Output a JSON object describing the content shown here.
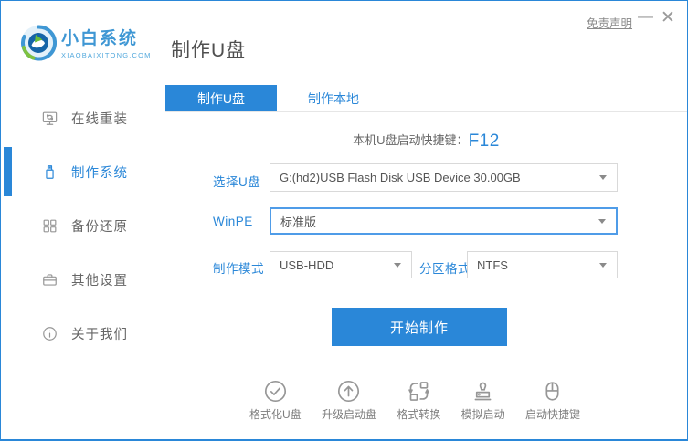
{
  "window_title": "小白系统 - 制作U盘",
  "colors": {
    "primary": "#2a87d8",
    "focus_border": "#4f9ce8",
    "sidebar_text": "#666666",
    "tool_icon": "#969696"
  },
  "header": {
    "brand_name": "小白系统",
    "brand_domain": "XIAOBAIXITONG.COM",
    "page_title": "制作U盘",
    "disclaimer_link": "免责声明",
    "minimize_glyph": "—",
    "close_glyph": "✕"
  },
  "sidebar": {
    "items": [
      {
        "label": "在线重装",
        "icon": "monitor-reinstall-icon",
        "active": false
      },
      {
        "label": "制作系统",
        "icon": "usb-drive-icon",
        "active": true
      },
      {
        "label": "备份还原",
        "icon": "backup-restore-icon",
        "active": false
      },
      {
        "label": "其他设置",
        "icon": "toolbox-icon",
        "active": false
      },
      {
        "label": "关于我们",
        "icon": "info-icon",
        "active": false
      }
    ]
  },
  "main": {
    "tabs": [
      {
        "label": "制作U盘",
        "active": true
      },
      {
        "label": "制作本地",
        "active": false
      }
    ],
    "hotkey_prefix": "本机U盘启动快捷键：",
    "hotkey_key": "F12",
    "form": {
      "usb": {
        "label": "选择U盘",
        "value": "G:(hd2)USB Flash Disk USB Device 30.00GB"
      },
      "winpe": {
        "label": "WinPE",
        "value": "标准版"
      },
      "mode": {
        "label": "制作模式",
        "value": "USB-HDD"
      },
      "partition": {
        "label": "分区格式",
        "value": "NTFS"
      }
    },
    "start_button": "开始制作",
    "tools": [
      {
        "label": "格式化U盘",
        "icon": "format-usb-icon"
      },
      {
        "label": "升级启动盘",
        "icon": "upgrade-boot-icon"
      },
      {
        "label": "格式转换",
        "icon": "format-convert-icon"
      },
      {
        "label": "模拟启动",
        "icon": "simulate-boot-icon"
      },
      {
        "label": "启动快捷键",
        "icon": "boot-hotkey-icon"
      }
    ]
  }
}
